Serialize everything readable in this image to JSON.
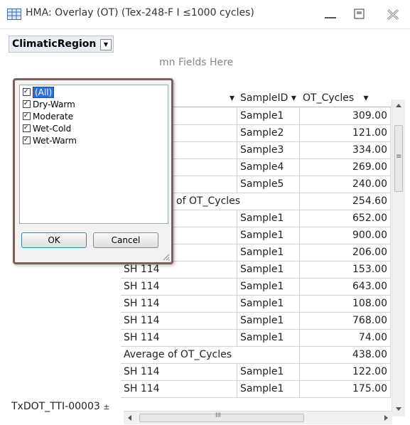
{
  "window": {
    "title": "HMA: Overlay (OT) (Tex-248-F I ≤1000 cycles)",
    "minimize_glyph": "—",
    "maximize_glyph": "□",
    "close_glyph": "✕"
  },
  "pivot": {
    "filter_field": "ClimaticRegion",
    "column_drop_hint": "Drop Column Fields Here",
    "column_drop_visible": "mn Fields Here",
    "headers": {
      "highway_arrow": "▾",
      "sample_id": "SampleID",
      "sample_arrow": "▾",
      "ot_cycles": "OT_Cycles",
      "ot_arrow": "▾"
    },
    "rows": [
      {
        "highway": "",
        "sample": "Sample1",
        "ot": "309.00"
      },
      {
        "highway": "",
        "sample": "Sample2",
        "ot": "121.00"
      },
      {
        "highway": "",
        "sample": "Sample3",
        "ot": "334.00"
      },
      {
        "highway": "",
        "sample": "Sample4",
        "ot": "269.00"
      },
      {
        "highway": "",
        "sample": "Sample5",
        "ot": "240.00"
      },
      {
        "avg_label": "of OT_Cycles",
        "ot": "254.60"
      },
      {
        "highway": "",
        "sample": "Sample1",
        "ot": "652.00"
      },
      {
        "highway": "SH 114",
        "sample": "Sample1",
        "ot": "900.00"
      },
      {
        "highway": "SH 114",
        "sample": "Sample1",
        "ot": "206.00"
      },
      {
        "highway": "SH 114",
        "sample": "Sample1",
        "ot": "153.00"
      },
      {
        "highway": "SH 114",
        "sample": "Sample1",
        "ot": "643.00"
      },
      {
        "highway": "SH 114",
        "sample": "Sample1",
        "ot": "108.00"
      },
      {
        "highway": "SH 114",
        "sample": "Sample1",
        "ot": "768.00"
      },
      {
        "highway": "SH 114",
        "sample": "Sample1",
        "ot": "74.00"
      },
      {
        "avg_label": "Average of OT_Cycles",
        "ot": "438.00"
      },
      {
        "highway": "SH 114",
        "sample": "Sample1",
        "ot": "122.00"
      },
      {
        "highway": "SH 114",
        "sample": "Sample1",
        "ot": "175.00"
      }
    ],
    "row_label": "TxDOT_TTI-00003",
    "row_toggle": "±"
  },
  "filter_popup": {
    "items": [
      {
        "label": "(All)",
        "checked": true,
        "selected": true
      },
      {
        "label": "Dry-Warm",
        "checked": true
      },
      {
        "label": "Moderate",
        "checked": true
      },
      {
        "label": "Wet-Cold",
        "checked": true
      },
      {
        "label": "Wet-Warm",
        "checked": true
      }
    ],
    "ok_label": "OK",
    "cancel_label": "Cancel"
  },
  "scrollbar": {
    "h_thumb_glyph": "III",
    "v_thumb_glyph": "≡"
  }
}
